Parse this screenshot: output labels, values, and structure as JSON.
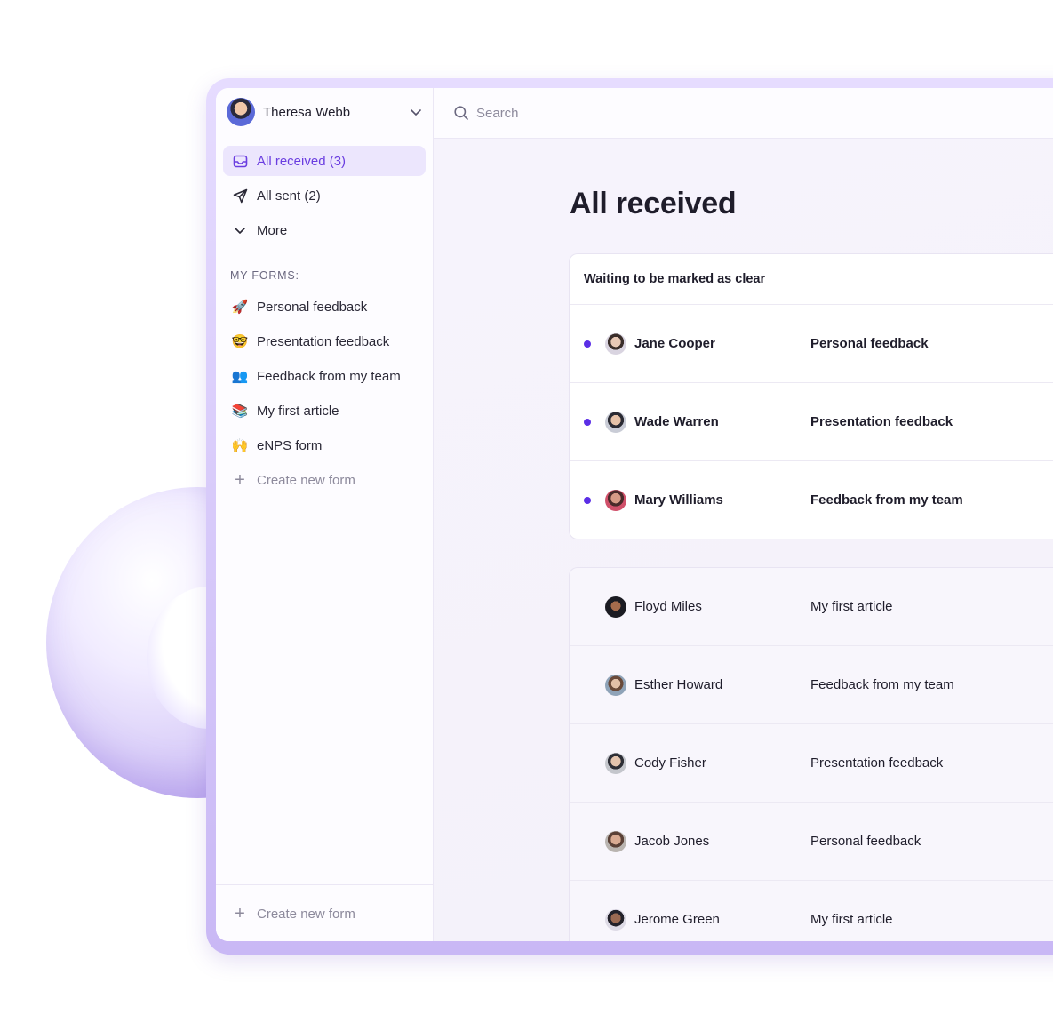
{
  "user": {
    "name": "Theresa Webb"
  },
  "nav": [
    {
      "label": "All received (3)",
      "icon": "inbox-icon",
      "active": true
    },
    {
      "label": "All sent (2)",
      "icon": "send-icon",
      "active": false
    },
    {
      "label": "More",
      "icon": "chevron-down-icon",
      "active": false
    }
  ],
  "forms": {
    "section_label": "MY FORMS:",
    "items": [
      {
        "emoji": "🚀",
        "label": "Personal feedback"
      },
      {
        "emoji": "🤓",
        "label": "Presentation feedback"
      },
      {
        "emoji": "👥",
        "label": "Feedback from my team"
      },
      {
        "emoji": "📚",
        "label": "My first article"
      },
      {
        "emoji": "🙌",
        "label": "eNPS form"
      }
    ],
    "create_label": "Create new form"
  },
  "footer": {
    "create_label": "Create new form"
  },
  "search": {
    "placeholder": "Search"
  },
  "page_title": "All received",
  "waiting": {
    "header": "Waiting to be marked as clear",
    "rows": [
      {
        "name": "Jane Cooper",
        "form": "Personal feedback",
        "avatar_color": "#c9b8a8"
      },
      {
        "name": "Wade Warren",
        "form": "Presentation feedback",
        "avatar_color": "#8f8f98"
      },
      {
        "name": "Mary Williams",
        "form": "Feedback from my team",
        "avatar_color": "#d0506a"
      }
    ]
  },
  "others": {
    "rows": [
      {
        "name": "Floyd Miles",
        "form": "My first article",
        "avatar_color": "#2b2b33"
      },
      {
        "name": "Esther Howard",
        "form": "Feedback from my team",
        "avatar_color": "#7b8a9c"
      },
      {
        "name": "Cody Fisher",
        "form": "Presentation feedback",
        "avatar_color": "#6e7077"
      },
      {
        "name": "Jacob Jones",
        "form": "Personal feedback",
        "avatar_color": "#9a8f88"
      },
      {
        "name": "Jerome Green",
        "form": "My first article",
        "avatar_color": "#3c3a44"
      }
    ]
  },
  "colors": {
    "accent": "#6a3de0",
    "unread_dot": "#5b2ee6",
    "active_bg": "#ece6fd"
  }
}
